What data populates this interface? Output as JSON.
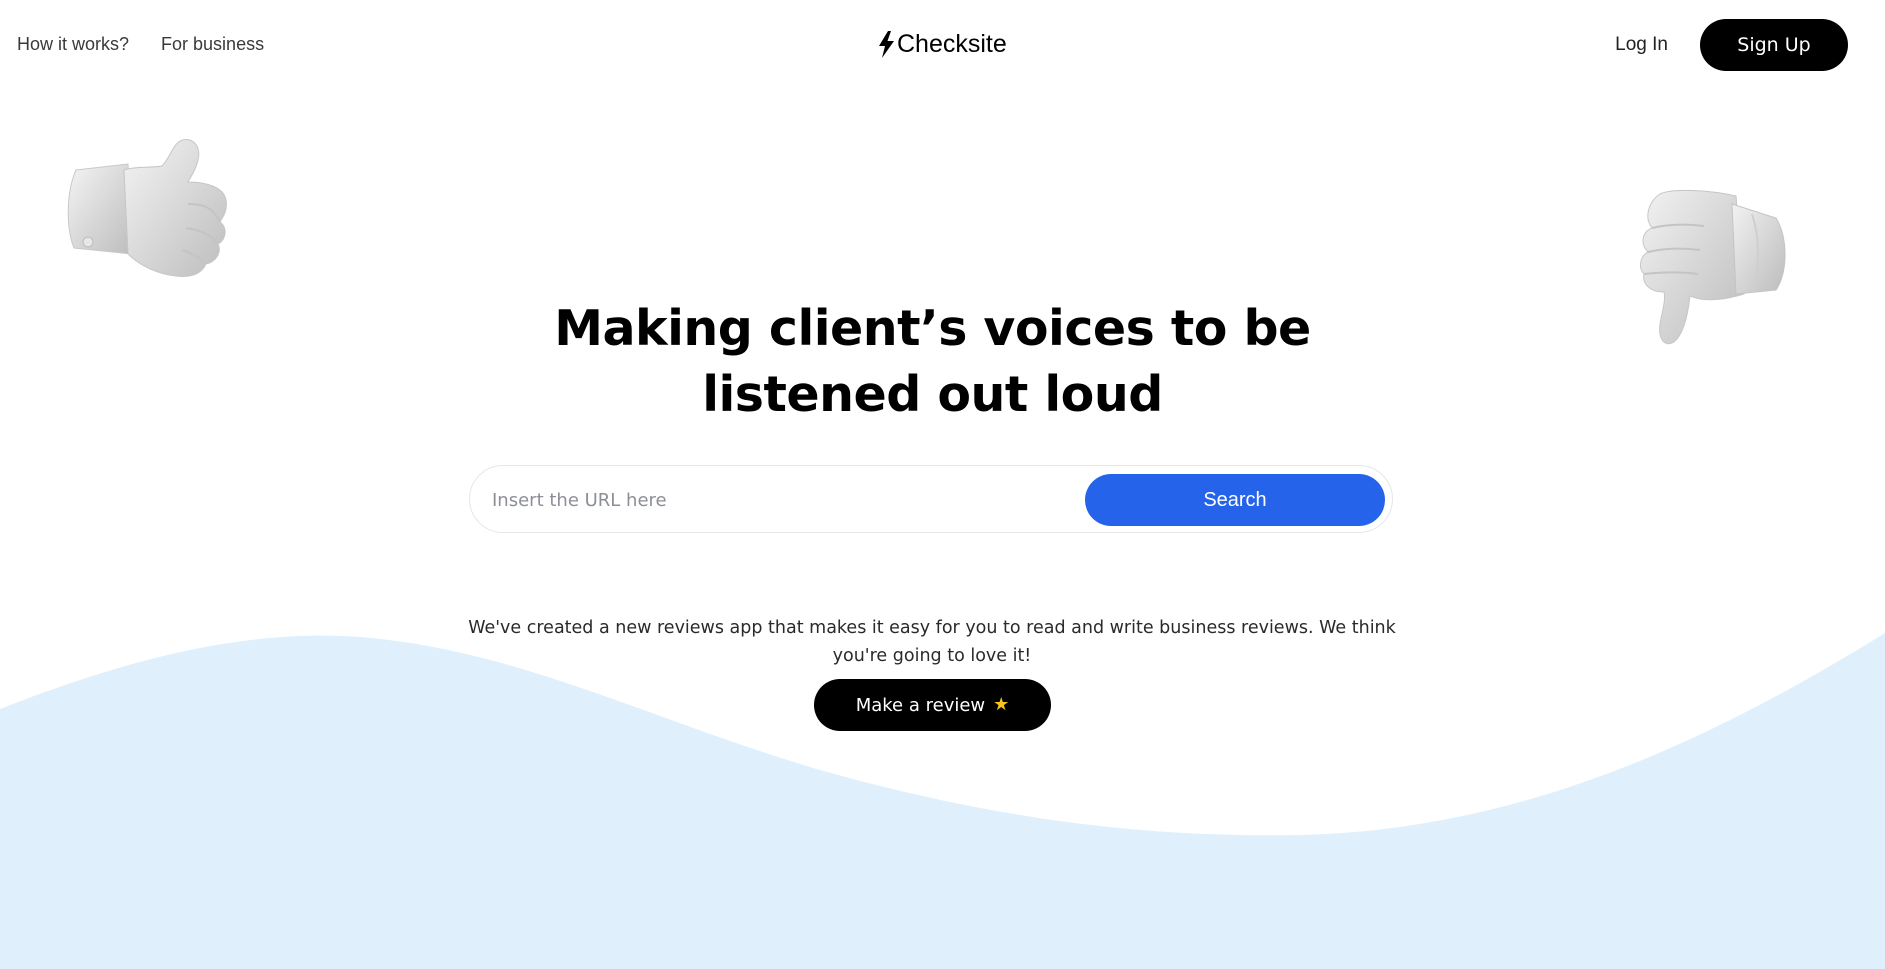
{
  "nav": {
    "links": [
      {
        "label": "How it works?"
      },
      {
        "label": "For business"
      }
    ],
    "logo": {
      "text": "Checksite",
      "icon": "lightning-bolt-icon"
    },
    "login_label": "Log In",
    "signup_label": "Sign Up"
  },
  "hero": {
    "title": "Making client’s voices to be listened out loud",
    "search": {
      "placeholder": "Insert the URL here",
      "value": "",
      "button_label": "Search"
    },
    "description": "We've created a new reviews app that makes it easy for you to read and write business reviews. We think you're going to love it!",
    "review_button": {
      "label": "Make a review",
      "icon": "star-icon"
    }
  },
  "decorations": {
    "left_image": "thumbs-up-icon",
    "right_image": "thumbs-down-icon"
  },
  "colors": {
    "accent": "#2563eb",
    "wave": "#dff0fc",
    "primary_button": "#000000",
    "star": "#f5c518"
  }
}
